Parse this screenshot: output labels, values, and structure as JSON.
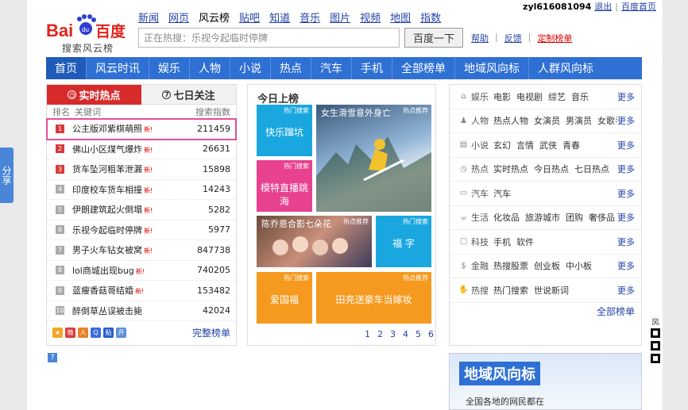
{
  "user": {
    "name": "zyl616081094",
    "logout": "退出",
    "home": "百度首页"
  },
  "topnav": [
    "新闻",
    "网页",
    "风云榜",
    "贴吧",
    "知道",
    "音乐",
    "图片",
    "视频",
    "地图",
    "指数"
  ],
  "logo": {
    "brand": "Bai百度",
    "sub": "搜索风云榜"
  },
  "search": {
    "placeholder": "正在热搜：乐视今起临时停牌",
    "button": "百度一下"
  },
  "help": {
    "help": "帮助",
    "feedback": "反馈",
    "custom": "定制榜单"
  },
  "mainnav": [
    "首页",
    "风云时讯",
    "娱乐",
    "人物",
    "小说",
    "热点",
    "汽车",
    "手机",
    "全部榜单",
    "地域风向标",
    "人群风向标"
  ],
  "share": "分享",
  "left": {
    "tab_on": "实时热点",
    "tab_off": "七日关注",
    "head": {
      "rank": "排名",
      "kw": "关键词",
      "idx": "搜索指数"
    },
    "rows": [
      {
        "n": "1",
        "kw": "公主版邓紫棋萌照",
        "new": "新!",
        "v": "211459"
      },
      {
        "n": "2",
        "kw": "佛山小区煤气爆炸",
        "new": "新!",
        "v": "26631"
      },
      {
        "n": "3",
        "kw": "货车坠河粗苯泄漏",
        "new": "新!",
        "v": "15898"
      },
      {
        "n": "4",
        "kw": "印度校车货车相撞",
        "new": "新!",
        "v": "14243"
      },
      {
        "n": "5",
        "kw": "伊朗建筑起火倒塌",
        "new": "新!",
        "v": "5282"
      },
      {
        "n": "6",
        "kw": "乐视今起临时停牌",
        "new": "新!",
        "v": "5977"
      },
      {
        "n": "7",
        "kw": "男子火车钻女被窝",
        "new": "新!",
        "v": "847738"
      },
      {
        "n": "8",
        "kw": "lol商城出现bug",
        "new": "新!",
        "v": "740205"
      },
      {
        "n": "9",
        "kw": "蓝瘦香菇哥结婚",
        "new": "新!",
        "v": "153482"
      },
      {
        "n": "10",
        "kw": "醉倒草丛误被击毙",
        "new": "",
        "v": "42024"
      }
    ],
    "full": "完整榜单",
    "help_mark": "?"
  },
  "mid": {
    "title": "今日上榜",
    "tiles": [
      {
        "tag": "热门搜索",
        "txt": "快乐蹿坑"
      },
      {
        "tag": "热点推荐",
        "txt": "女生滑雪意外身亡"
      },
      {
        "tag": "热门搜索",
        "txt": "模特直播跳海"
      },
      {
        "tag": "热点推荐",
        "txt": "陈乔恩合影七朵花"
      },
      {
        "tag": "热门搜索",
        "txt": "福 字"
      },
      {
        "tag": "热门搜索",
        "txt": "爱国福"
      },
      {
        "tag": "热点推荐",
        "txt": "田亮送豪车当嫁妆"
      }
    ],
    "pages": [
      "1",
      "2",
      "3",
      "4",
      "5",
      "6"
    ]
  },
  "right": {
    "rows": [
      {
        "cat": "娱乐",
        "icon": "tag-icon",
        "links": [
          "电影",
          "电视剧",
          "综艺",
          "音乐"
        ]
      },
      {
        "cat": "人物",
        "icon": "person-icon",
        "links": [
          "热点人物",
          "女演员",
          "男演员",
          "女歌手"
        ]
      },
      {
        "cat": "小说",
        "icon": "book-icon",
        "links": [
          "玄幻",
          "言情",
          "武侠",
          "青春"
        ]
      },
      {
        "cat": "热点",
        "icon": "clock-icon",
        "links": [
          "实时热点",
          "今日热点",
          "七日热点"
        ]
      },
      {
        "cat": "汽车",
        "icon": "car-icon",
        "links": [
          "汽车"
        ]
      },
      {
        "cat": "生活",
        "icon": "cup-icon",
        "links": [
          "化妆品",
          "旅游城市",
          "团购",
          "奢侈品"
        ]
      },
      {
        "cat": "科技",
        "icon": "monitor-icon",
        "links": [
          "手机",
          "软件"
        ]
      },
      {
        "cat": "金融",
        "icon": "dollar-icon",
        "links": [
          "热搜股票",
          "创业板",
          "中小板"
        ]
      },
      {
        "cat": "热搜",
        "icon": "hands-icon",
        "links": [
          "热门搜索",
          "世说新词"
        ]
      }
    ],
    "more": "更多",
    "all": "全部榜单"
  },
  "banner": {
    "title": "地域风向标",
    "sub": "全国各地的网民都在"
  },
  "qr_label": "风"
}
